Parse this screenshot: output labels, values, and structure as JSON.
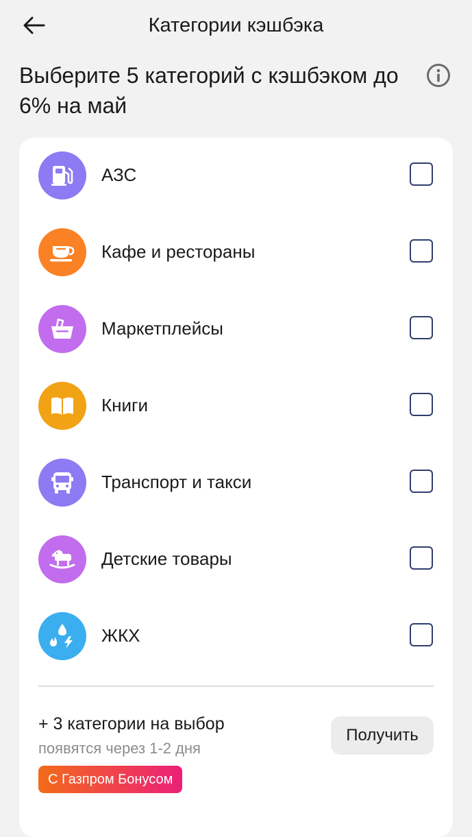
{
  "header": {
    "title": "Категории кэшбэка"
  },
  "heading": "Выберите 5 категорий с кэшбэком до 6% на май",
  "colors": {
    "purple": "#8c7bf3",
    "orange": "#fa8225",
    "pink": "#c26ded",
    "amber": "#f2a215",
    "blue": "#3aaeef",
    "checkbox_border": "#2f3d6e",
    "badge_gradient_start": "#f36b19",
    "badge_gradient_end": "#ec1f7a"
  },
  "categories": [
    {
      "label": "АЗС",
      "icon": "gas-station-icon",
      "color": "#8c7bf3",
      "checked": false
    },
    {
      "label": "Кафе и рестораны",
      "icon": "coffee-cup-icon",
      "color": "#fa8225",
      "checked": false
    },
    {
      "label": "Маркетплейсы",
      "icon": "shopping-basket-icon",
      "color": "#c26ded",
      "checked": false
    },
    {
      "label": "Книги",
      "icon": "book-icon",
      "color": "#f2a215",
      "checked": false
    },
    {
      "label": "Транспорт и такси",
      "icon": "bus-icon",
      "color": "#8c7bf3",
      "checked": false
    },
    {
      "label": "Детские товары",
      "icon": "rocking-horse-icon",
      "color": "#c26ded",
      "checked": false
    },
    {
      "label": "ЖКХ",
      "icon": "utilities-icon",
      "color": "#3aaeef",
      "checked": false
    }
  ],
  "extra": {
    "title": "+ 3 категории на выбор",
    "subtitle": "появятся через 1-2 дня",
    "button_label": "Получить",
    "badge_label": "С Газпром Бонусом"
  }
}
